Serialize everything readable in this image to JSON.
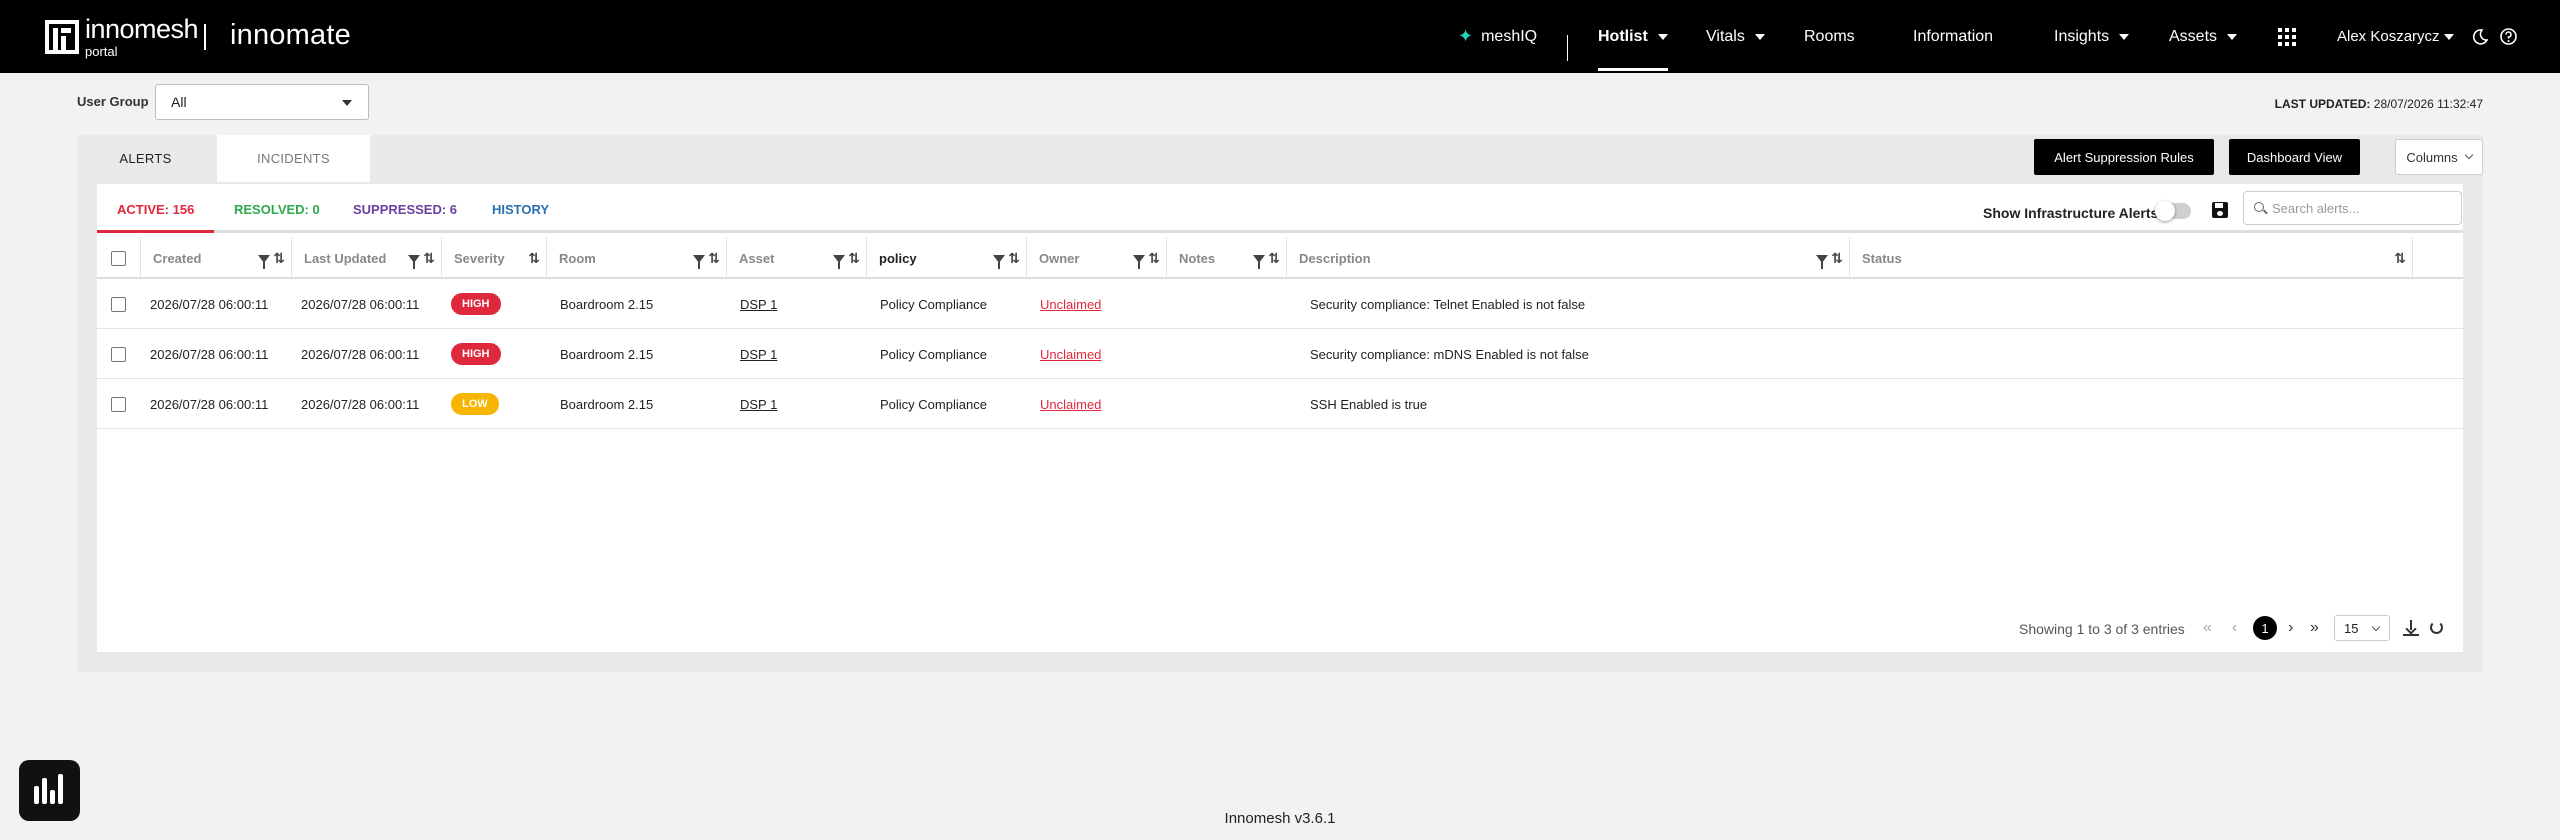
{
  "header": {
    "logo_brand": "innomesh",
    "logo_sub": "portal",
    "product": "innomate",
    "nav": {
      "meshiq": "meshIQ",
      "hotlist": "Hotlist",
      "vitals": "Vitals",
      "rooms": "Rooms",
      "information": "Information",
      "insights": "Insights",
      "assets": "Assets",
      "user": "Alex Koszarycz"
    },
    "accent_color": "#27d3b5"
  },
  "filters": {
    "user_group_label": "User Group",
    "user_group_value": "All",
    "last_updated_label": "LAST UPDATED:",
    "last_updated_value": "28/07/2026 11:32:47"
  },
  "tabs": {
    "alerts": "ALERTS",
    "incidents": "INCIDENTS"
  },
  "buttons": {
    "suppression_rules": "Alert Suppression Rules",
    "dashboard_view": "Dashboard View",
    "columns": "Columns"
  },
  "stats": {
    "active": "ACTIVE: 156",
    "resolved": "RESOLVED: 0",
    "suppressed": "SUPPRESSED: 6",
    "history": "HISTORY",
    "active_color": "#e0283c",
    "resolved_color": "#2eaa4a",
    "suppressed_color": "#6b3fa0",
    "history_color": "#2a6fb0"
  },
  "toolbar": {
    "infra_label": "Show Infrastructure Alerts",
    "search_placeholder": "Search alerts..."
  },
  "table": {
    "columns": {
      "created": "Created",
      "last_updated": "Last Updated",
      "severity": "Severity",
      "room": "Room",
      "asset": "Asset",
      "policy": "policy",
      "owner": "Owner",
      "notes": "Notes",
      "description": "Description",
      "status": "Status"
    },
    "rows": [
      {
        "created": "2026/07/28 06:00:11",
        "last_updated": "2026/07/28 06:00:11",
        "severity": "HIGH",
        "room": "Boardroom 2.15",
        "asset": "DSP 1",
        "policy": "Policy Compliance",
        "owner": "Unclaimed",
        "notes": "",
        "description": "Security compliance: Telnet Enabled is not false",
        "status": ""
      },
      {
        "created": "2026/07/28 06:00:11",
        "last_updated": "2026/07/28 06:00:11",
        "severity": "HIGH",
        "room": "Boardroom 2.15",
        "asset": "DSP 1",
        "policy": "Policy Compliance",
        "owner": "Unclaimed",
        "notes": "",
        "description": "Security compliance: mDNS Enabled is not false",
        "status": ""
      },
      {
        "created": "2026/07/28 06:00:11",
        "last_updated": "2026/07/28 06:00:11",
        "severity": "LOW",
        "room": "Boardroom 2.15",
        "asset": "DSP 1",
        "policy": "Policy Compliance",
        "owner": "Unclaimed",
        "notes": "",
        "description": "SSH Enabled is true",
        "status": ""
      }
    ]
  },
  "pagination": {
    "summary": "Showing 1 to 3 of 3 entries",
    "current_page": "1",
    "per_page": "15"
  },
  "footer": {
    "version": "Innomesh v3.6.1"
  }
}
